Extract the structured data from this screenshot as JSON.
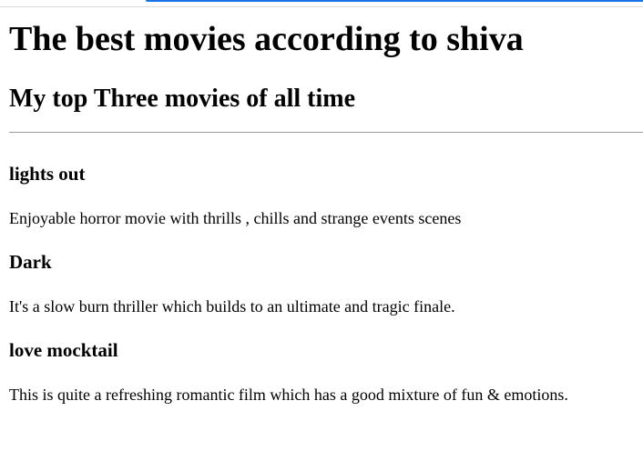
{
  "page": {
    "heading": "The best movies according to shiva",
    "subheading": "My top Three movies of all time"
  },
  "movies": [
    {
      "title": "lights out",
      "description": "Enjoyable horror movie with thrills , chills and strange events scenes"
    },
    {
      "title": "Dark",
      "description": "It's a slow burn thriller which builds to an ultimate and tragic finale."
    },
    {
      "title": "love mocktail",
      "description": "This is quite a refreshing romantic film which has a good mixture of fun & emotions."
    }
  ],
  "colors": {
    "text": "#000000",
    "background": "#ffffff",
    "divider": "#9a9a9a",
    "browser_accent": "#1a73e8"
  }
}
